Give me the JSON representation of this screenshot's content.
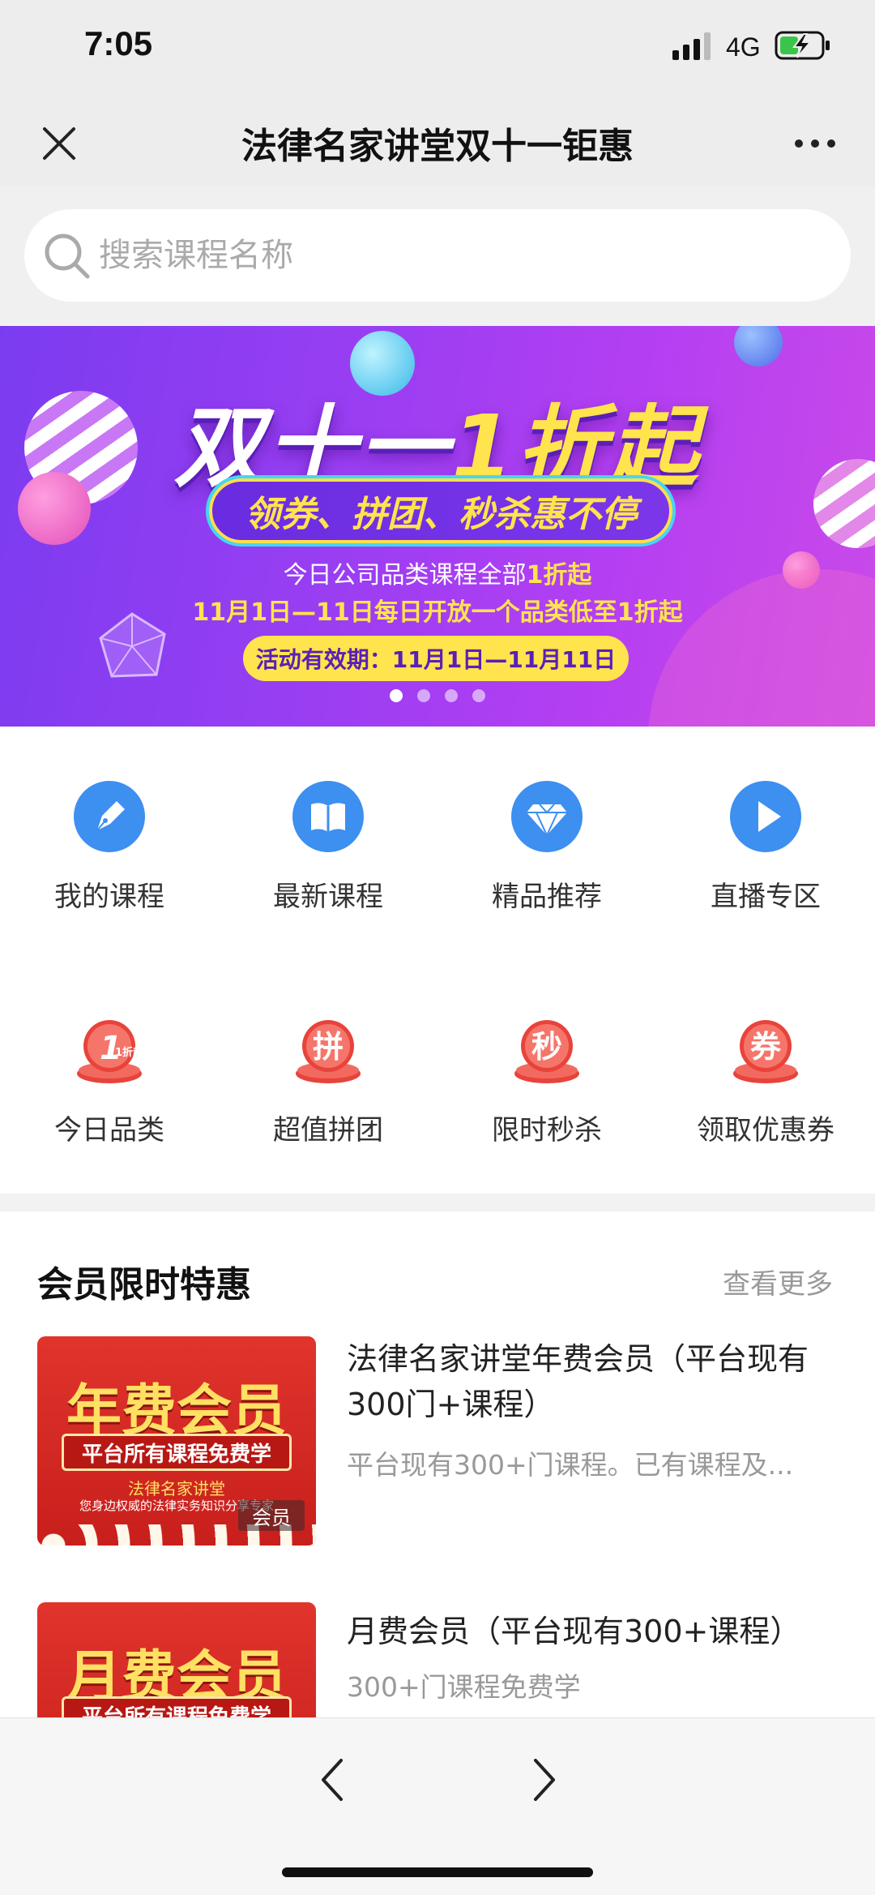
{
  "status_bar": {
    "time": "7:05",
    "network": "4G"
  },
  "header": {
    "title": "法律名家讲堂双十一钜惠"
  },
  "search": {
    "placeholder": "搜索课程名称"
  },
  "banner": {
    "title_main": "双十一",
    "title_highlight": "1折起",
    "pill": "领券、拼团、秒杀惠不停",
    "line1_prefix": "今日公司品类课程全部",
    "line1_highlight": "1折起",
    "line2": "11月1日—11日每日开放一个品类低至1折起",
    "valid": "活动有效期：11月1日—11月11日",
    "dots_total": 4,
    "dots_active_index": 0
  },
  "categories": [
    {
      "label": "我的课程",
      "icon": "pen-icon"
    },
    {
      "label": "最新课程",
      "icon": "book-icon"
    },
    {
      "label": "精品推荐",
      "icon": "diamond-icon"
    },
    {
      "label": "直播专区",
      "icon": "play-icon"
    },
    {
      "label": "今日品类",
      "icon": "one-discount-icon",
      "badge": "1折起"
    },
    {
      "label": "超值拼团",
      "icon": "group-buy-icon",
      "badge": "拼"
    },
    {
      "label": "限时秒杀",
      "icon": "flash-sale-icon",
      "badge": "秒"
    },
    {
      "label": "领取优惠券",
      "icon": "coupon-icon",
      "badge": "券"
    }
  ],
  "member_section": {
    "title": "会员限时特惠",
    "more": "查看更多",
    "courses": [
      {
        "thumb_title": "年费会员",
        "thumb_bar": "平台所有课程免费学",
        "thumb_sub1": "法律名家讲堂",
        "thumb_sub2": "您身边权威的法律实务知识分享专家",
        "thumb_tag": "会员",
        "title": "法律名家讲堂年费会员（平台现有300门+课程）",
        "desc": "平台现有300+门课程。已有课程及..."
      },
      {
        "thumb_title": "月费会员",
        "thumb_bar": "平台所有课程免费学",
        "title": "月费会员（平台现有300+课程）",
        "desc": "300+门课程免费学"
      }
    ]
  },
  "colors": {
    "accent_blue": "#3d8ff0",
    "accent_red": "#e8433b",
    "banner_purple": "#8b3cf0",
    "banner_yellow": "#ffe44d"
  }
}
